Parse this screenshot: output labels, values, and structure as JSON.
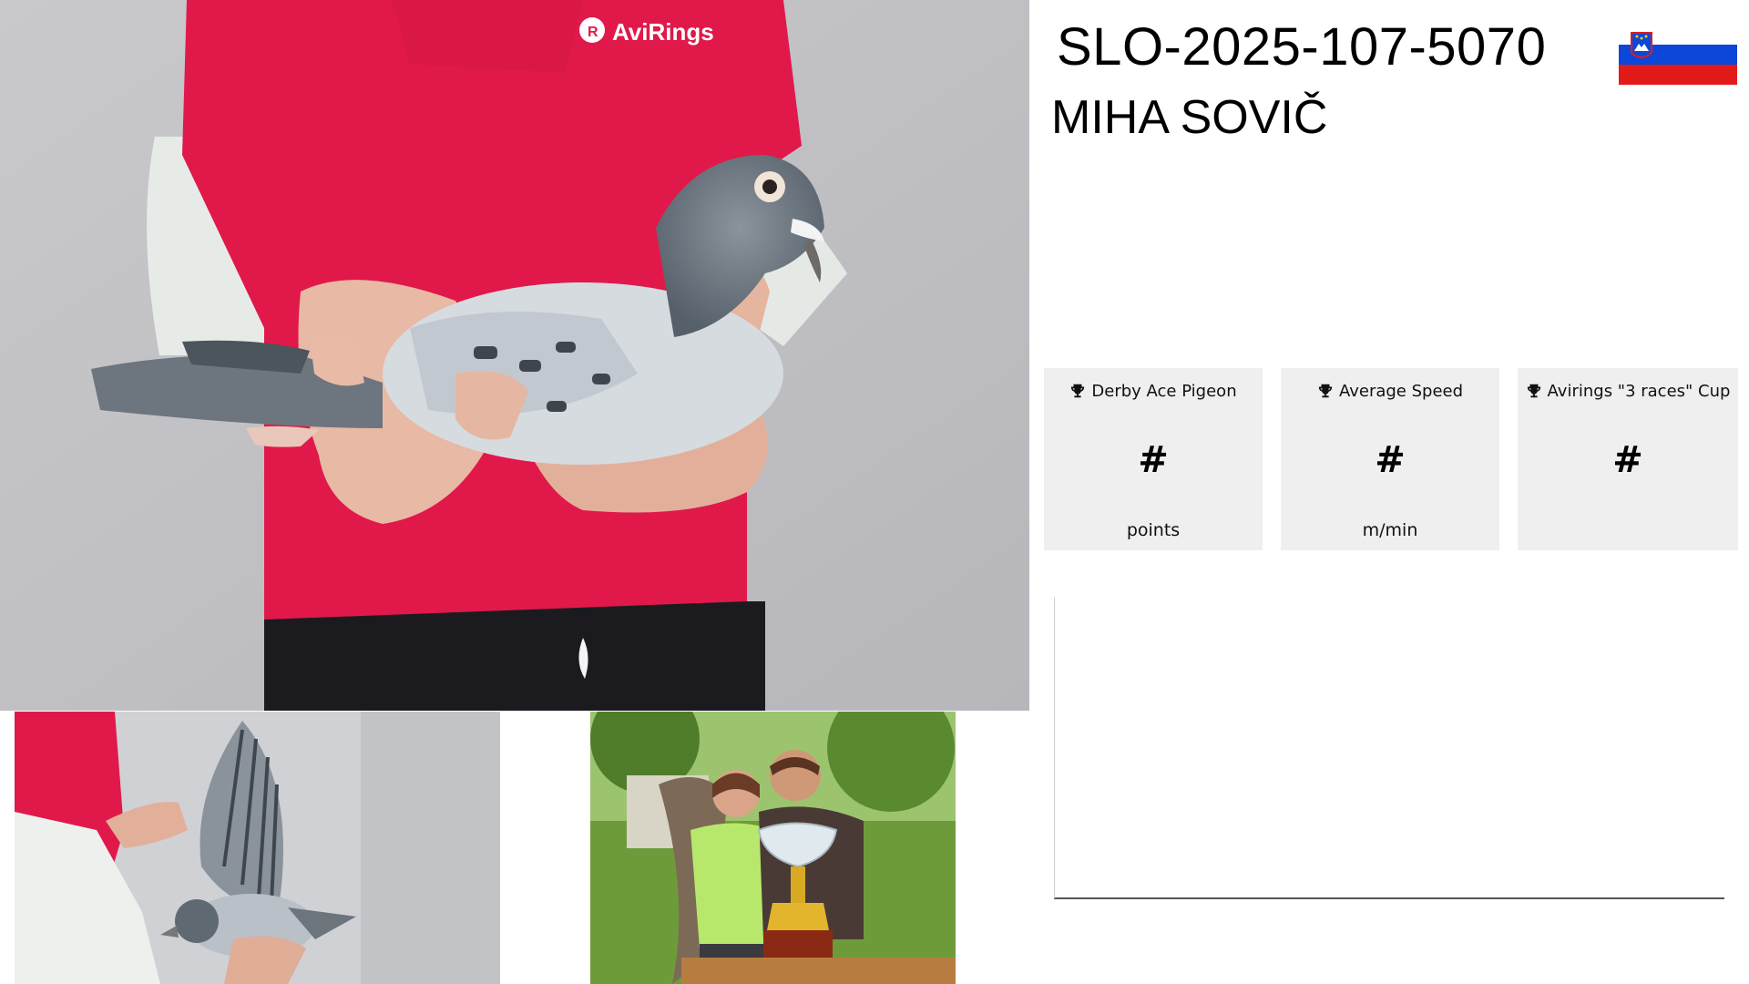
{
  "pigeon": {
    "ring_number": "SLO-2025-107-5070",
    "owner_name": "MIHA SOVIČ",
    "country_flag": "slovenia-flag",
    "flag_colors": [
      "#ffffff",
      "#0d47d9",
      "#e21a1a"
    ]
  },
  "photos": {
    "main": {
      "shirt_logo": "AviRings"
    },
    "wing": {},
    "owners": {}
  },
  "stats": [
    {
      "icon": "trophy-icon",
      "title": "Derby Ace Pigeon",
      "value": "#",
      "unit": "points"
    },
    {
      "icon": "trophy-icon",
      "title": "Average Speed",
      "value": "#",
      "unit": "m/min"
    },
    {
      "icon": "trophy-icon",
      "title": "Avirings \"3 races\" Cup",
      "value": "#",
      "unit": ""
    }
  ],
  "colors": {
    "card_background": "#efefef",
    "text": "#000000",
    "shirt_red": "#e0194a"
  }
}
